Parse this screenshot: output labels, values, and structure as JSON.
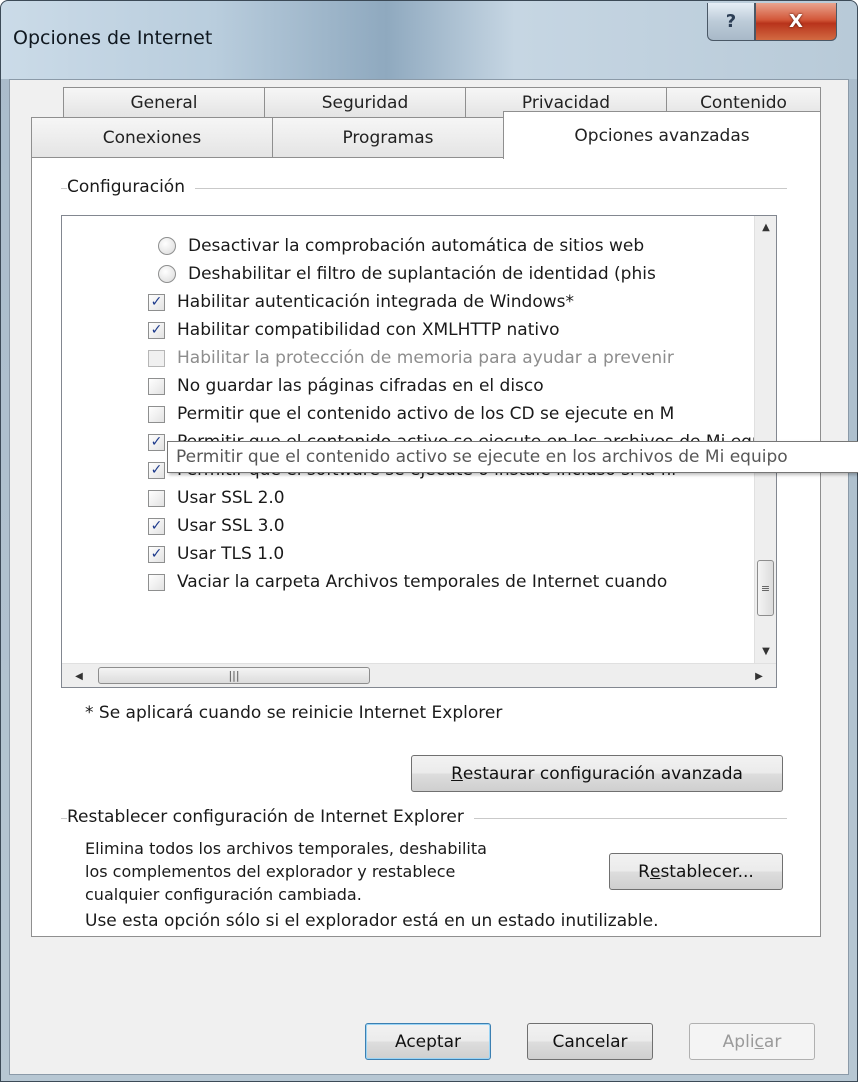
{
  "window": {
    "title": "Opciones de Internet",
    "help_label": "?",
    "close_label": "X"
  },
  "tabs_row1": [
    "General",
    "Seguridad",
    "Privacidad",
    "Contenido"
  ],
  "tabs_row2": [
    "Conexiones",
    "Programas",
    "Opciones avanzadas"
  ],
  "config": {
    "group_label": "Configuración",
    "items": [
      {
        "type": "radio",
        "checked": false,
        "label": "Desactivar la comprobación automática de sitios web",
        "disabled": false
      },
      {
        "type": "radio",
        "checked": false,
        "label": "Deshabilitar el filtro de suplantación de identidad (phis",
        "disabled": false
      },
      {
        "type": "checkbox",
        "checked": true,
        "label": "Habilitar autenticación integrada de Windows*",
        "disabled": false
      },
      {
        "type": "checkbox",
        "checked": true,
        "label": "Habilitar compatibilidad con XMLHTTP nativo",
        "disabled": false
      },
      {
        "type": "checkbox",
        "checked": false,
        "label": "Habilitar la protección de memoria para ayudar a prevenir",
        "disabled": true
      },
      {
        "type": "checkbox",
        "checked": false,
        "label": "No guardar las páginas cifradas en el disco",
        "disabled": false
      },
      {
        "type": "checkbox",
        "checked": false,
        "label": "Permitir que el contenido activo de los CD se ejecute en M",
        "disabled": false
      },
      {
        "type": "checkbox",
        "checked": true,
        "label": "Permitir que el contenido activo se ejecute en los archivos de Mi equipo",
        "disabled": false
      },
      {
        "type": "checkbox",
        "checked": true,
        "label": "Permitir que el software se ejecute o instale incluso si la fir",
        "disabled": false
      },
      {
        "type": "checkbox",
        "checked": false,
        "label": "Usar SSL 2.0",
        "disabled": false
      },
      {
        "type": "checkbox",
        "checked": true,
        "label": "Usar SSL 3.0",
        "disabled": false
      },
      {
        "type": "checkbox",
        "checked": true,
        "label": "Usar TLS 1.0",
        "disabled": false
      },
      {
        "type": "checkbox",
        "checked": false,
        "label": "Vaciar la carpeta Archivos temporales de Internet cuando",
        "disabled": false
      }
    ],
    "tooltip": "Permitir que el contenido activo se ejecute en los archivos de Mi equipo",
    "note": "* Se aplicará cuando se reinicie Internet Explorer",
    "restore_button": {
      "pre": "",
      "key": "R",
      "post": "estaurar configuración avanzada"
    }
  },
  "reset": {
    "group_label": "Restablecer configuración de Internet Explorer",
    "desc_lines": [
      "Elimina todos los archivos temporales, deshabilita",
      "los complementos del explorador y restablece",
      "cualquier configuración cambiada."
    ],
    "warning": "Use esta opción sólo si el explorador está en un estado inutilizable.",
    "button": {
      "pre": "R",
      "key": "e",
      "post": "stablecer..."
    }
  },
  "footer": {
    "ok": "Aceptar",
    "cancel": "Cancelar",
    "apply": {
      "pre": "Apli",
      "key": "c",
      "post": "ar"
    }
  },
  "icons": {
    "scroll_up": "▲",
    "scroll_down": "▼",
    "scroll_left": "◀",
    "scroll_right": "▶",
    "grip_v": "≡",
    "grip_h": "|||",
    "check": "✓"
  }
}
